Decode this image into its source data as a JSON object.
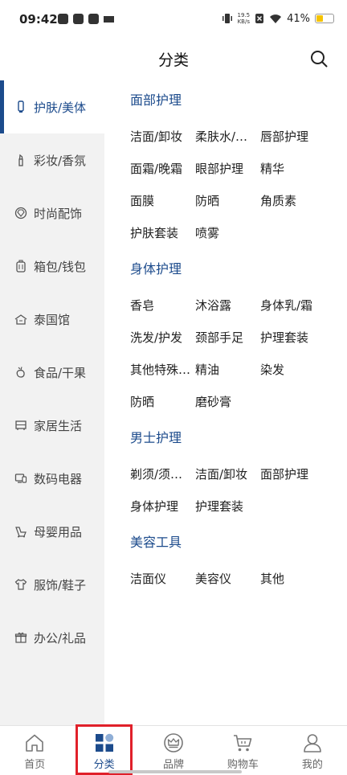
{
  "status": {
    "time": "09:42",
    "net_speed_top": "19.5",
    "net_speed_bottom": "KB/s",
    "battery_pct": "41%",
    "battery_level": 0.41
  },
  "header": {
    "title": "分类"
  },
  "sidebar": {
    "items": [
      {
        "label": "护肤/美体",
        "icon": "tube-icon"
      },
      {
        "label": "彩妆/香氛",
        "icon": "lipstick-icon"
      },
      {
        "label": "时尚配饰",
        "icon": "gem-icon"
      },
      {
        "label": "箱包/钱包",
        "icon": "luggage-icon"
      },
      {
        "label": "泰国馆",
        "icon": "temple-icon"
      },
      {
        "label": "食品/干果",
        "icon": "fruit-icon"
      },
      {
        "label": "家居生活",
        "icon": "furniture-icon"
      },
      {
        "label": "数码电器",
        "icon": "device-icon"
      },
      {
        "label": "母婴用品",
        "icon": "baby-icon"
      },
      {
        "label": "服饰/鞋子",
        "icon": "shirt-icon"
      },
      {
        "label": "办公/礼品",
        "icon": "gift-icon"
      }
    ]
  },
  "sections": [
    {
      "title": "面部护理",
      "items": [
        "洁面/卸妆",
        "柔肤水/…",
        "唇部护理",
        "面霜/晚霜",
        "眼部护理",
        "精华",
        "面膜",
        "防晒",
        "角质素",
        "护肤套装",
        "喷雾"
      ]
    },
    {
      "title": "身体护理",
      "items": [
        "香皂",
        "沐浴露",
        "身体乳/霜",
        "洗发/护发",
        "颈部手足",
        "护理套装",
        "其他特殊…",
        "精油",
        "染发",
        "防晒",
        "磨砂膏"
      ]
    },
    {
      "title": "男士护理",
      "items": [
        "剃须/须…",
        "洁面/卸妆",
        "面部护理",
        "身体护理",
        "护理套装"
      ]
    },
    {
      "title": "美容工具",
      "items": [
        "洁面仪",
        "美容仪",
        "其他"
      ]
    }
  ],
  "bottom_nav": {
    "items": [
      {
        "label": "首页",
        "icon": "home-icon"
      },
      {
        "label": "分类",
        "icon": "category-icon"
      },
      {
        "label": "品牌",
        "icon": "crown-icon"
      },
      {
        "label": "购物车",
        "icon": "cart-icon"
      },
      {
        "label": "我的",
        "icon": "user-icon"
      }
    ]
  },
  "colors": {
    "accent": "#1c4b8c",
    "highlight_border": "#e0202a",
    "sidebar_bg": "#f2f2f2"
  }
}
